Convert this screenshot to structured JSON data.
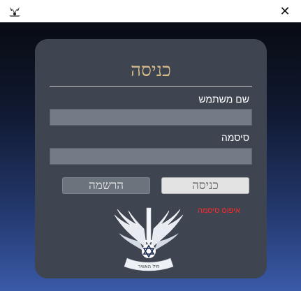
{
  "window": {
    "close_glyph": "✕",
    "app_icon": "app-icon"
  },
  "login": {
    "title": "כניסה",
    "username_label": "שם משתמש",
    "username_value": "",
    "password_label": "סיסמה",
    "password_value": "",
    "login_button": "כניסה",
    "register_button": "הרשמה",
    "reset_password_link": "איפוס סיסמה",
    "emblem": "air-force-emblem"
  },
  "colors": {
    "title_gold": "#d8bd8a",
    "card": "#3e4450",
    "link_red": "#ff2a2a"
  }
}
